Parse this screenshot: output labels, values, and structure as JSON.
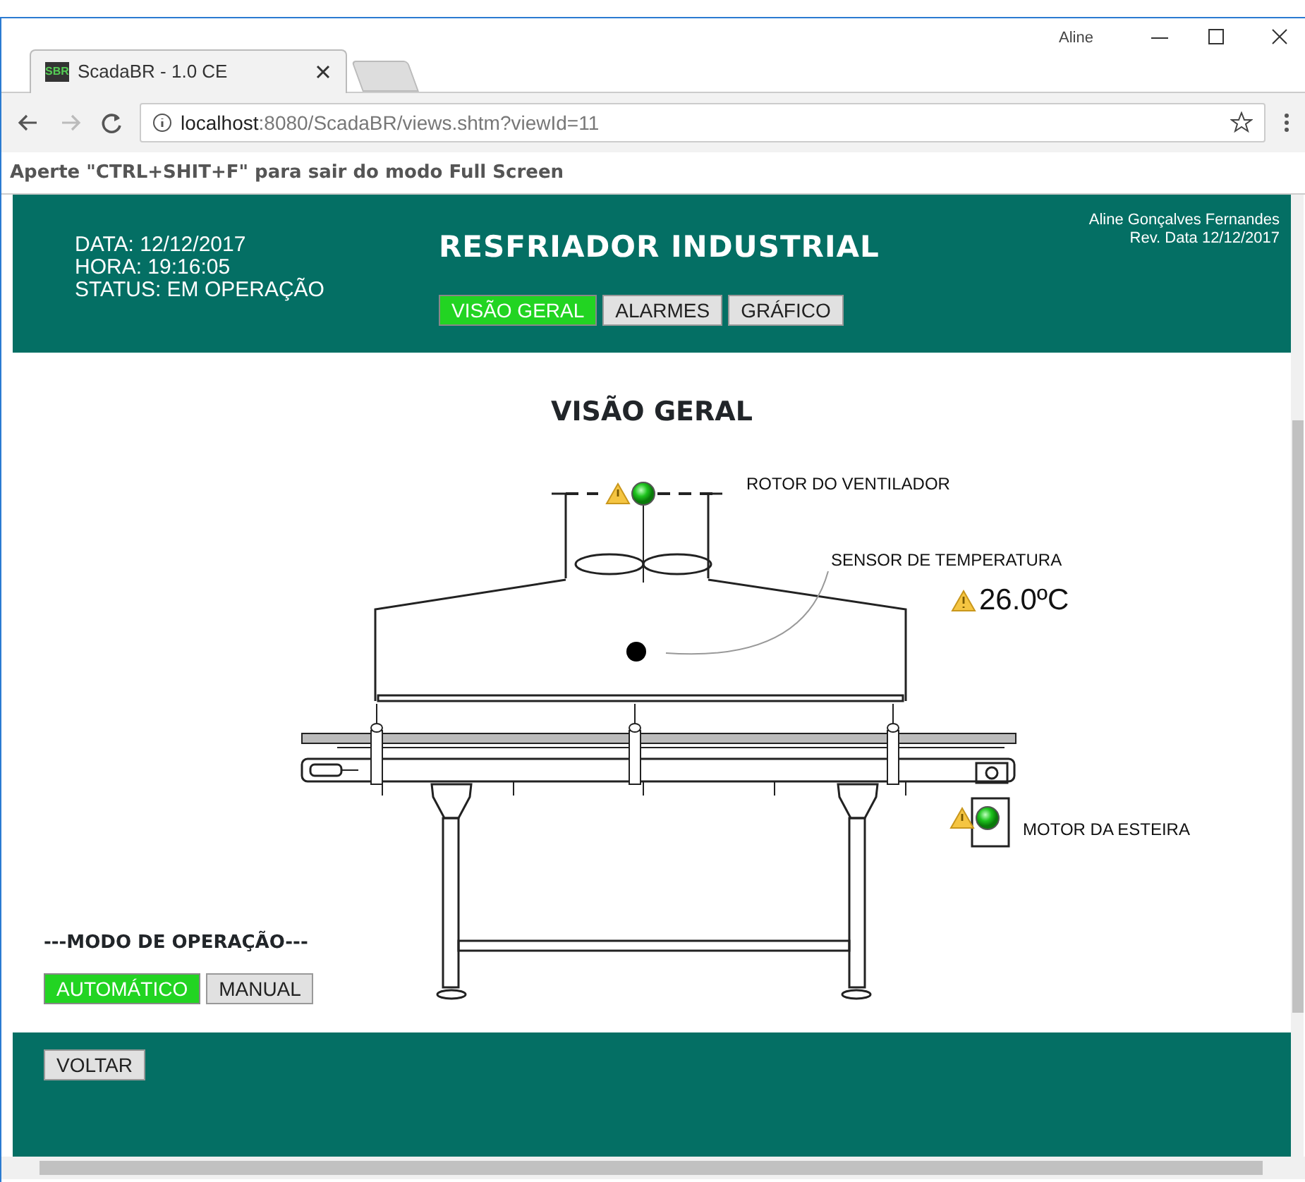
{
  "browser": {
    "user": "Aline",
    "tabs": [
      {
        "title": "ScadaBR - 1.0 CE",
        "favicon": "SBR",
        "selected": true
      }
    ],
    "url_host": "localhost",
    "url_rest": ":8080/ScadaBR/views.shtm?viewId=11"
  },
  "fullscreen_hint": "Aperte \"CTRL+SHIT+F\" para sair do modo Full Screen",
  "header": {
    "info": [
      "DATA: 12/12/2017",
      "HORA: 19:16:05",
      "STATUS: EM OPERAÇÃO"
    ],
    "title": "RESFRIADOR INDUSTRIAL",
    "nav": [
      {
        "label": "VISÃO GERAL",
        "selected": true
      },
      {
        "label": "ALARMES",
        "selected": false
      },
      {
        "label": "GRÁFICO",
        "selected": false
      }
    ],
    "author": "Aline Gonçalves Fernandes",
    "revision": "Rev. Data 12/12/2017"
  },
  "view": {
    "title": "VISÃO GERAL",
    "points": [
      {
        "kind": "status",
        "label": "ROTOR DO VENTILADOR",
        "alarm": true,
        "on": true
      },
      {
        "kind": "value",
        "label": "SENSOR DE TEMPERATURA",
        "alarm": true,
        "value": "26.0ºC"
      },
      {
        "kind": "status",
        "label": "MOTOR DA ESTEIRA",
        "alarm": true,
        "on": true
      }
    ]
  },
  "mode": {
    "title": "---MODO DE OPERAÇÃO---",
    "options": [
      {
        "label": "AUTOMÁTICO",
        "selected": true
      },
      {
        "label": "MANUAL",
        "selected": false
      }
    ]
  },
  "footer": {
    "buttons": [
      "VOLTAR"
    ]
  }
}
